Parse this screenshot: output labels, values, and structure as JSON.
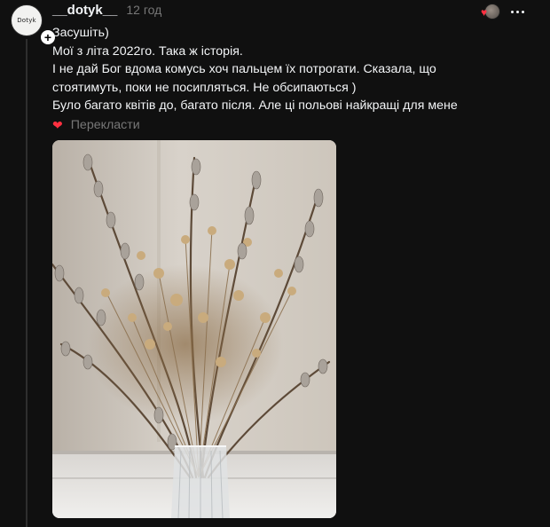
{
  "post": {
    "username": "__dotyk__",
    "time": "12 год",
    "avatar_logo_text": "Dotyk",
    "text_lines": [
      "Засушіть)",
      "Мої з літа 2022го. Така ж історія.",
      "І не дай Бог вдома комусь хоч пальцем їх потрогати. Сказала, що",
      "стоятимуть, поки не посипляться. Не обсипаються )",
      "Було багато квітів до, багато після. Але ці польові найкращі для мене"
    ],
    "translate_label": "Перекласти",
    "icons": {
      "reaction": "heart-icon",
      "more": "more-options-icon",
      "follow": "plus-icon",
      "translate_heart": "heart-icon"
    }
  },
  "colors": {
    "background": "#101010",
    "text": "#f3f5f7",
    "muted": "#777777",
    "heart": "#ff3040",
    "thread_line": "#2e2e2e"
  }
}
